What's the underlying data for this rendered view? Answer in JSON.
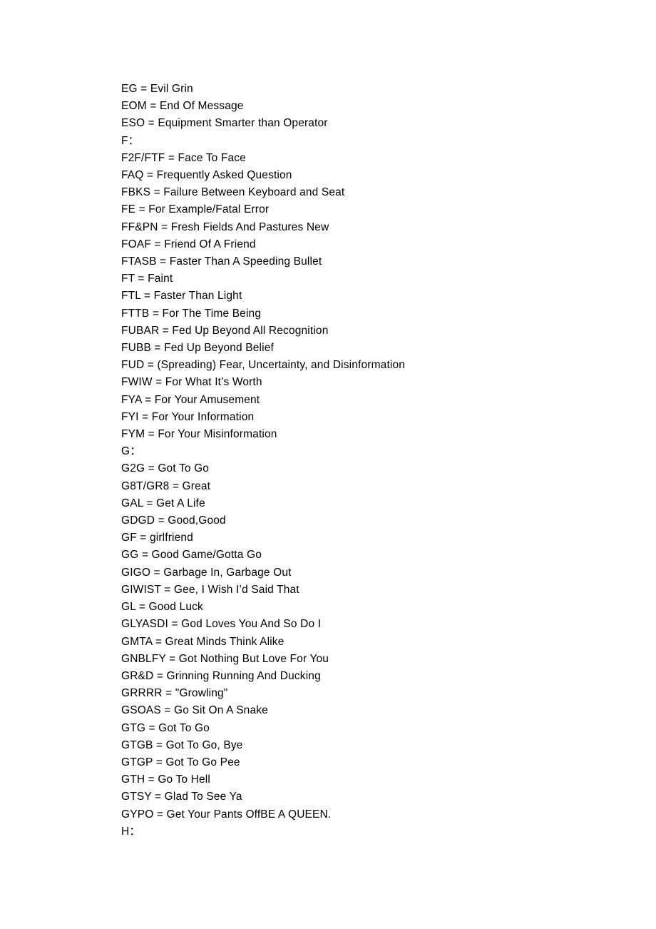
{
  "document": {
    "type": "text-page",
    "page_background": "#ffffff",
    "text_color": "#000000",
    "lines": [
      {
        "text": "EG = Evil Grin",
        "kind": "entry"
      },
      {
        "text": "EOM = End Of Message",
        "kind": "entry"
      },
      {
        "text": "ESO = Equipment Smarter than Operator",
        "kind": "entry"
      },
      {
        "text": "F：",
        "kind": "section"
      },
      {
        "text": "F2F/FTF = Face To Face",
        "kind": "entry"
      },
      {
        "text": "FAQ = Frequently Asked Question",
        "kind": "entry"
      },
      {
        "text": "FBKS = Failure Between Keyboard and Seat",
        "kind": "entry"
      },
      {
        "text": "FE = For Example/Fatal Error",
        "kind": "entry"
      },
      {
        "text": "FF&PN = Fresh Fields And Pastures New",
        "kind": "entry"
      },
      {
        "text": "FOAF = Friend Of A Friend",
        "kind": "entry"
      },
      {
        "text": "FTASB = Faster Than A Speeding Bullet",
        "kind": "entry"
      },
      {
        "text": "FT = Faint",
        "kind": "entry"
      },
      {
        "text": "FTL = Faster Than Light",
        "kind": "entry"
      },
      {
        "text": "FTTB = For The Time Being",
        "kind": "entry"
      },
      {
        "text": "FUBAR = Fed Up Beyond All Recognition",
        "kind": "entry"
      },
      {
        "text": "FUBB = Fed Up Beyond Belief",
        "kind": "entry"
      },
      {
        "text": "FUD = (Spreading) Fear, Uncertainty, and Disinformation",
        "kind": "entry"
      },
      {
        "text": "FWIW = For What It’s Worth",
        "kind": "entry"
      },
      {
        "text": "FYA = For Your Amusement",
        "kind": "entry"
      },
      {
        "text": "FYI = For Your Information",
        "kind": "entry"
      },
      {
        "text": "FYM = For Your Misinformation",
        "kind": "entry"
      },
      {
        "text": "G：",
        "kind": "section"
      },
      {
        "text": "G2G = Got To Go",
        "kind": "entry"
      },
      {
        "text": "G8T/GR8 = Great",
        "kind": "entry"
      },
      {
        "text": "GAL = Get A Life",
        "kind": "entry"
      },
      {
        "text": "GDGD = Good,Good",
        "kind": "entry"
      },
      {
        "text": "GF = girlfriend",
        "kind": "entry"
      },
      {
        "text": "GG = Good Game/Gotta Go",
        "kind": "entry"
      },
      {
        "text": "GIGO = Garbage In, Garbage Out",
        "kind": "entry"
      },
      {
        "text": "GIWIST = Gee, I Wish I’d Said That",
        "kind": "entry"
      },
      {
        "text": "GL = Good Luck",
        "kind": "entry"
      },
      {
        "text": "GLYASDI = God Loves You And So Do I",
        "kind": "entry"
      },
      {
        "text": "GMTA = Great Minds Think Alike",
        "kind": "entry"
      },
      {
        "text": "GNBLFY = Got Nothing But Love For You",
        "kind": "entry"
      },
      {
        "text": "GR&D = Grinning Running And Ducking",
        "kind": "entry"
      },
      {
        "text": "GRRRR = \"Growling\"",
        "kind": "entry"
      },
      {
        "text": "GSOAS = Go Sit On A Snake",
        "kind": "entry"
      },
      {
        "text": "GTG = Got To Go",
        "kind": "entry"
      },
      {
        "text": "GTGB = Got To Go, Bye",
        "kind": "entry"
      },
      {
        "text": "GTGP = Got To Go Pee",
        "kind": "entry"
      },
      {
        "text": "GTH = Go To Hell",
        "kind": "entry"
      },
      {
        "text": "GTSY = Glad To See Ya",
        "kind": "entry"
      },
      {
        "text": "GYPO = Get Your Pants OffBE A QUEEN.",
        "kind": "entry"
      },
      {
        "text": "H：",
        "kind": "section"
      }
    ]
  }
}
